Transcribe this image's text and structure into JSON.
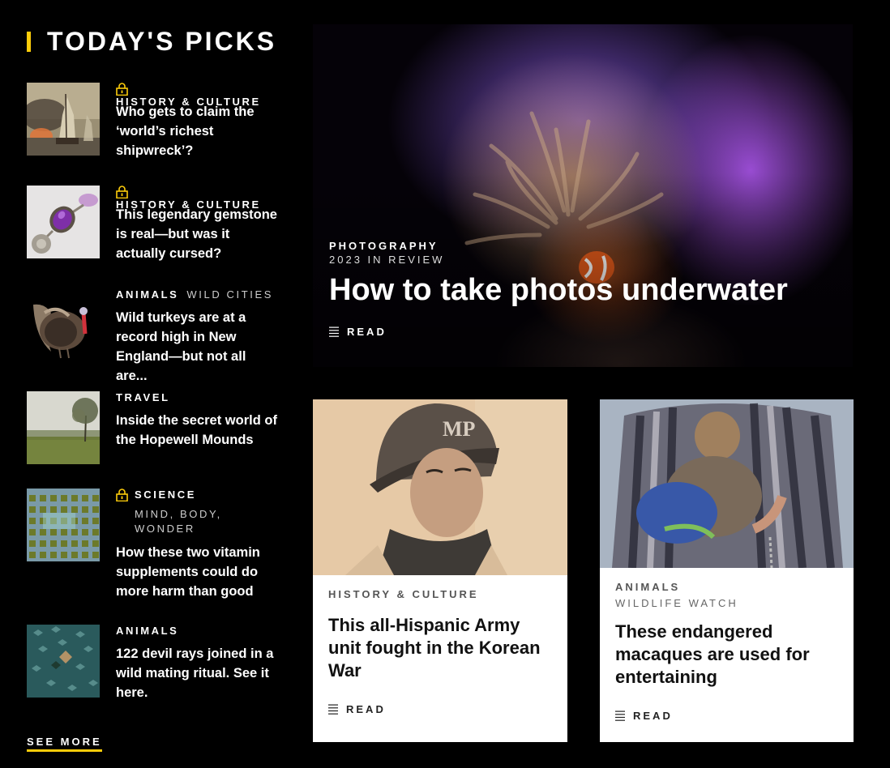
{
  "sidebar": {
    "title": "TODAY'S PICKS",
    "accent_color": "#fccc0a",
    "items": [
      {
        "locked": true,
        "kicker": "HISTORY & CULTURE",
        "sub_kicker": "",
        "title": "Who gets to claim the ‘world’s richest shipwreck’?",
        "thumb": "ship-battle-painting"
      },
      {
        "locked": true,
        "kicker": "HISTORY & CULTURE",
        "sub_kicker": "",
        "title": "This legendary gemstone is real—but was it actually cursed?",
        "thumb": "amethyst-jewel"
      },
      {
        "locked": false,
        "kicker": "ANIMALS",
        "sub_kicker": "WILD CITIES",
        "title": "Wild turkeys are at a record high in New England—but not all are...",
        "thumb": "wild-turkey"
      },
      {
        "locked": false,
        "kicker": "TRAVEL",
        "sub_kicker": "",
        "title": "Inside the secret world of the Hopewell Mounds",
        "thumb": "misty-field-tree"
      },
      {
        "locked": true,
        "kicker": "SCIENCE",
        "sub_kicker": "MIND, BODY, WONDER",
        "title": "How these two vitamin supplements could do more harm than good",
        "thumb": "vitamin-bottles"
      },
      {
        "locked": false,
        "kicker": "ANIMALS",
        "sub_kicker": "",
        "title": "122 devil rays joined in a wild mating ritual. See it here.",
        "thumb": "devil-rays-aerial"
      }
    ],
    "see_more": "SEE MORE"
  },
  "hero": {
    "kicker": "PHOTOGRAPHY",
    "sub_kicker": "2023 IN REVIEW",
    "title": "How to take photos underwater",
    "read_label": "READ",
    "image": "clownfish-in-purple-anemone"
  },
  "cards": [
    {
      "kicker": "HISTORY & CULTURE",
      "sub_kicker": "",
      "title": "This all-Hispanic Army unit fought in the Korean War",
      "read_label": "READ",
      "image": "soldier-mp-helmet-portrait"
    },
    {
      "kicker": "ANIMALS",
      "sub_kicker": "WILDLIFE WATCH",
      "title": "These endangered macaques are used for entertaining",
      "read_label": "READ",
      "image": "macaque-in-costume"
    }
  ]
}
